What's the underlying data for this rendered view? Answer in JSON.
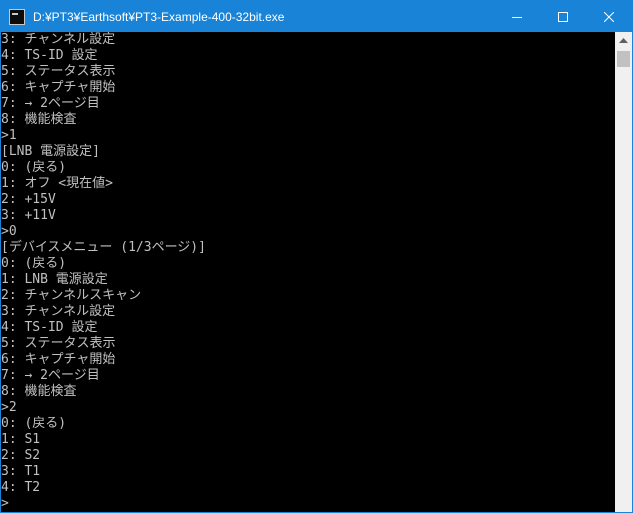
{
  "window": {
    "title": "D:¥PT3¥Earthsoft¥PT3-Example-400-32bit.exe",
    "icon": "console-app-icon",
    "controls": [
      "minimize-icon",
      "maximize-icon",
      "close-icon"
    ],
    "title_bar_color": "#1883d7"
  },
  "console": {
    "foreground": "#c0c0c0",
    "background": "#000000",
    "lines": [
      "3: チャンネル設定",
      "4: TS-ID 設定",
      "5: ステータス表示",
      "6: キャプチャ開始",
      "7: → 2ページ目",
      "8: 機能検査",
      ">1",
      "[LNB 電源設定]",
      "0: (戻る)",
      "1: オフ <現在値>",
      "2: +15V",
      "3: +11V",
      ">0",
      "[デバイスメニュー (1/3ページ)]",
      "0: (戻る)",
      "1: LNB 電源設定",
      "2: チャンネルスキャン",
      "3: チャンネル設定",
      "4: TS-ID 設定",
      "5: ステータス表示",
      "6: キャプチャ開始",
      "7: → 2ページ目",
      "8: 機能検査",
      ">2",
      "0: (戻る)",
      "1: S1",
      "2: S2",
      "3: T1",
      "4: T2",
      ">"
    ]
  },
  "scrollbar": {
    "icons": [
      "scroll-up-arrow-icon"
    ]
  }
}
